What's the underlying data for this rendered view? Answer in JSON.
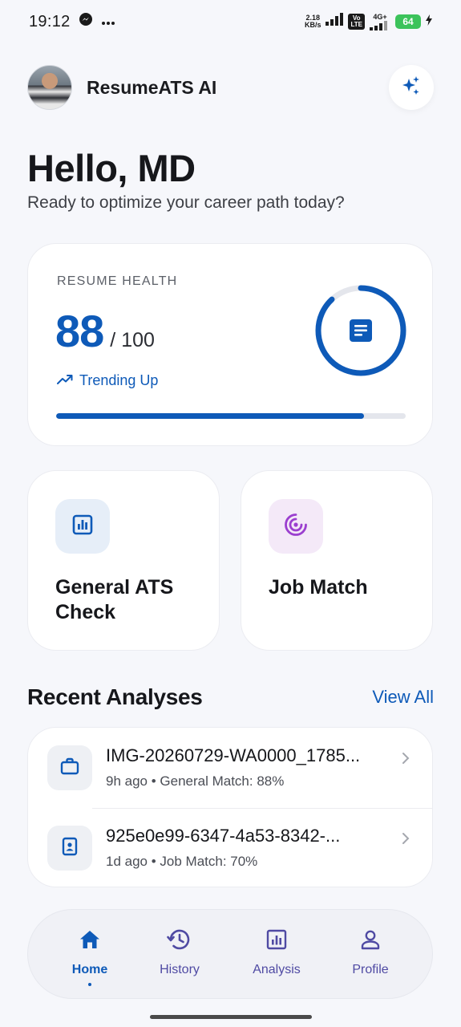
{
  "status_bar": {
    "time": "19:12",
    "netspeed_value": "2.18",
    "netspeed_unit": "KB/s",
    "lte_top": "Vo",
    "lte_bottom": "LTE",
    "network_type": "4G+",
    "battery": "64"
  },
  "header": {
    "app_title": "ResumeATS AI"
  },
  "greeting": {
    "title": "Hello, MD",
    "subtitle": "Ready to optimize your career path today?"
  },
  "health": {
    "label": "RESUME HEALTH",
    "score": "88",
    "max": "/ 100",
    "trend": "Trending Up",
    "progress_fraction": 0.88
  },
  "actions": {
    "ats_label": "General ATS Check",
    "job_label": "Job Match"
  },
  "recent": {
    "title": "Recent Analyses",
    "view_all": "View All",
    "items": [
      {
        "title": "IMG-20260729-WA0000_1785...",
        "meta": "9h ago • General Match: 88%"
      },
      {
        "title": "925e0e99-6347-4a53-8342-...",
        "meta": "1d ago • Job Match: 70%"
      }
    ]
  },
  "nav": {
    "home": "Home",
    "history": "History",
    "analysis": "Analysis",
    "profile": "Profile",
    "active": "home"
  },
  "colors": {
    "primary": "#0e5ab8",
    "nav_inactive": "#4f4aa3",
    "job_accent": "#9b3fcf",
    "background": "#f6f7fb"
  }
}
